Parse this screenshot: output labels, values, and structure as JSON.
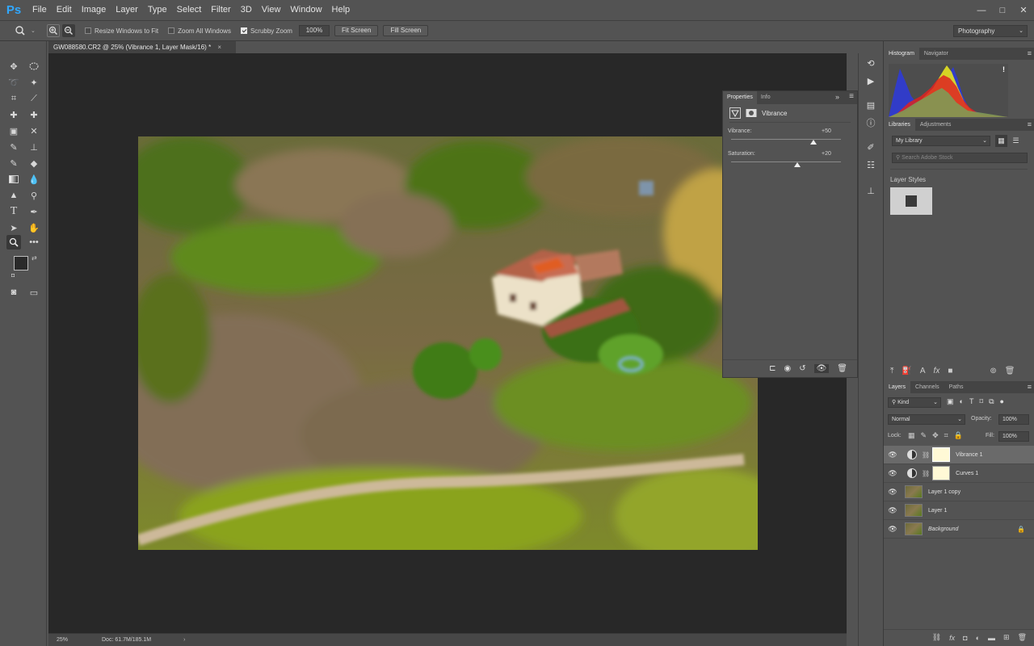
{
  "app": {
    "logo": "Ps"
  },
  "menu": [
    "File",
    "Edit",
    "Image",
    "Layer",
    "Type",
    "Select",
    "Filter",
    "3D",
    "View",
    "Window",
    "Help"
  ],
  "window_controls": [
    "—",
    "□",
    "✕"
  ],
  "options_bar": {
    "resize_windows": "Resize Windows to Fit",
    "zoom_all": "Zoom All Windows",
    "scrubby_zoom": "Scrubby Zoom",
    "zoom_value": "100%",
    "fit_screen": "Fit Screen",
    "fill_screen": "Fill Screen",
    "workspace": "Photography"
  },
  "document": {
    "tab_title": "GW088580.CR2 @ 25% (Vibrance 1, Layer Mask/16) *",
    "zoom": "25%",
    "doc_size": "Doc: 61.7M/185.1M"
  },
  "properties": {
    "tabs": [
      "Properties",
      "Info"
    ],
    "adjustment": "Vibrance",
    "vibrance_label": "Vibrance:",
    "vibrance_value": "+50",
    "vibrance_fraction": 0.75,
    "saturation_label": "Saturation:",
    "saturation_value": "+20",
    "saturation_fraction": 0.6
  },
  "histogram": {
    "tabs": [
      "Histogram",
      "Navigator"
    ],
    "warning": "!"
  },
  "libraries": {
    "tabs": [
      "Libraries",
      "Adjustments"
    ],
    "library_name": "My Library",
    "search_placeholder": "Search Adobe Stock",
    "layer_styles_label": "Layer Styles"
  },
  "layers": {
    "tabs": [
      "Layers",
      "Channels",
      "Paths"
    ],
    "filter_kind": "Kind",
    "blend_mode": "Normal",
    "opacity_label": "Opacity:",
    "opacity_value": "100%",
    "lock_label": "Lock:",
    "fill_label": "Fill:",
    "fill_value": "100%",
    "items": [
      {
        "name": "Vibrance 1",
        "type": "adjustment",
        "selected": true
      },
      {
        "name": "Curves 1",
        "type": "adjustment",
        "selected": false
      },
      {
        "name": "Layer 1 copy",
        "type": "pixel",
        "selected": false
      },
      {
        "name": "Layer 1",
        "type": "pixel",
        "selected": false
      },
      {
        "name": "Background",
        "type": "background",
        "selected": false
      }
    ]
  }
}
